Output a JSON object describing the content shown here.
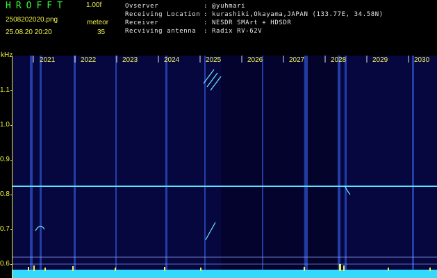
{
  "app": {
    "title": "HROFFT",
    "version": "1.00f",
    "filename": "2508202020.png",
    "datetime": "25.08.20 20:20",
    "meteor_label": "meteor",
    "meteor_count": "35"
  },
  "info": {
    "rows": [
      {
        "key": "Ovserver",
        "value": ": @yuhmari"
      },
      {
        "key": "Receiving Location",
        "value": ": kurashiki,Okayama,JAPAN (133.77E, 34.58N)"
      },
      {
        "key": "Receiver",
        "value": ": NESDR SMArt + HDSDR"
      },
      {
        "key": "Recviving antenna",
        "value": ": Radix RV-62V"
      }
    ]
  },
  "axis": {
    "y_unit": "kHz",
    "y_ticks": [
      "1.1",
      "1.0",
      "0.9",
      "0.8",
      "0.7",
      "0.6"
    ],
    "x_ticks": [
      "2021",
      "2022",
      "2023",
      "2024",
      "2025",
      "2026",
      "2027",
      "2028",
      "2029",
      "2030"
    ]
  },
  "colors": {
    "background": "#000000",
    "spectrum": "#06063a",
    "title_green": "#2fff2f",
    "label_yellow": "#f2f24a",
    "carrier": "#5fe0ff"
  }
}
